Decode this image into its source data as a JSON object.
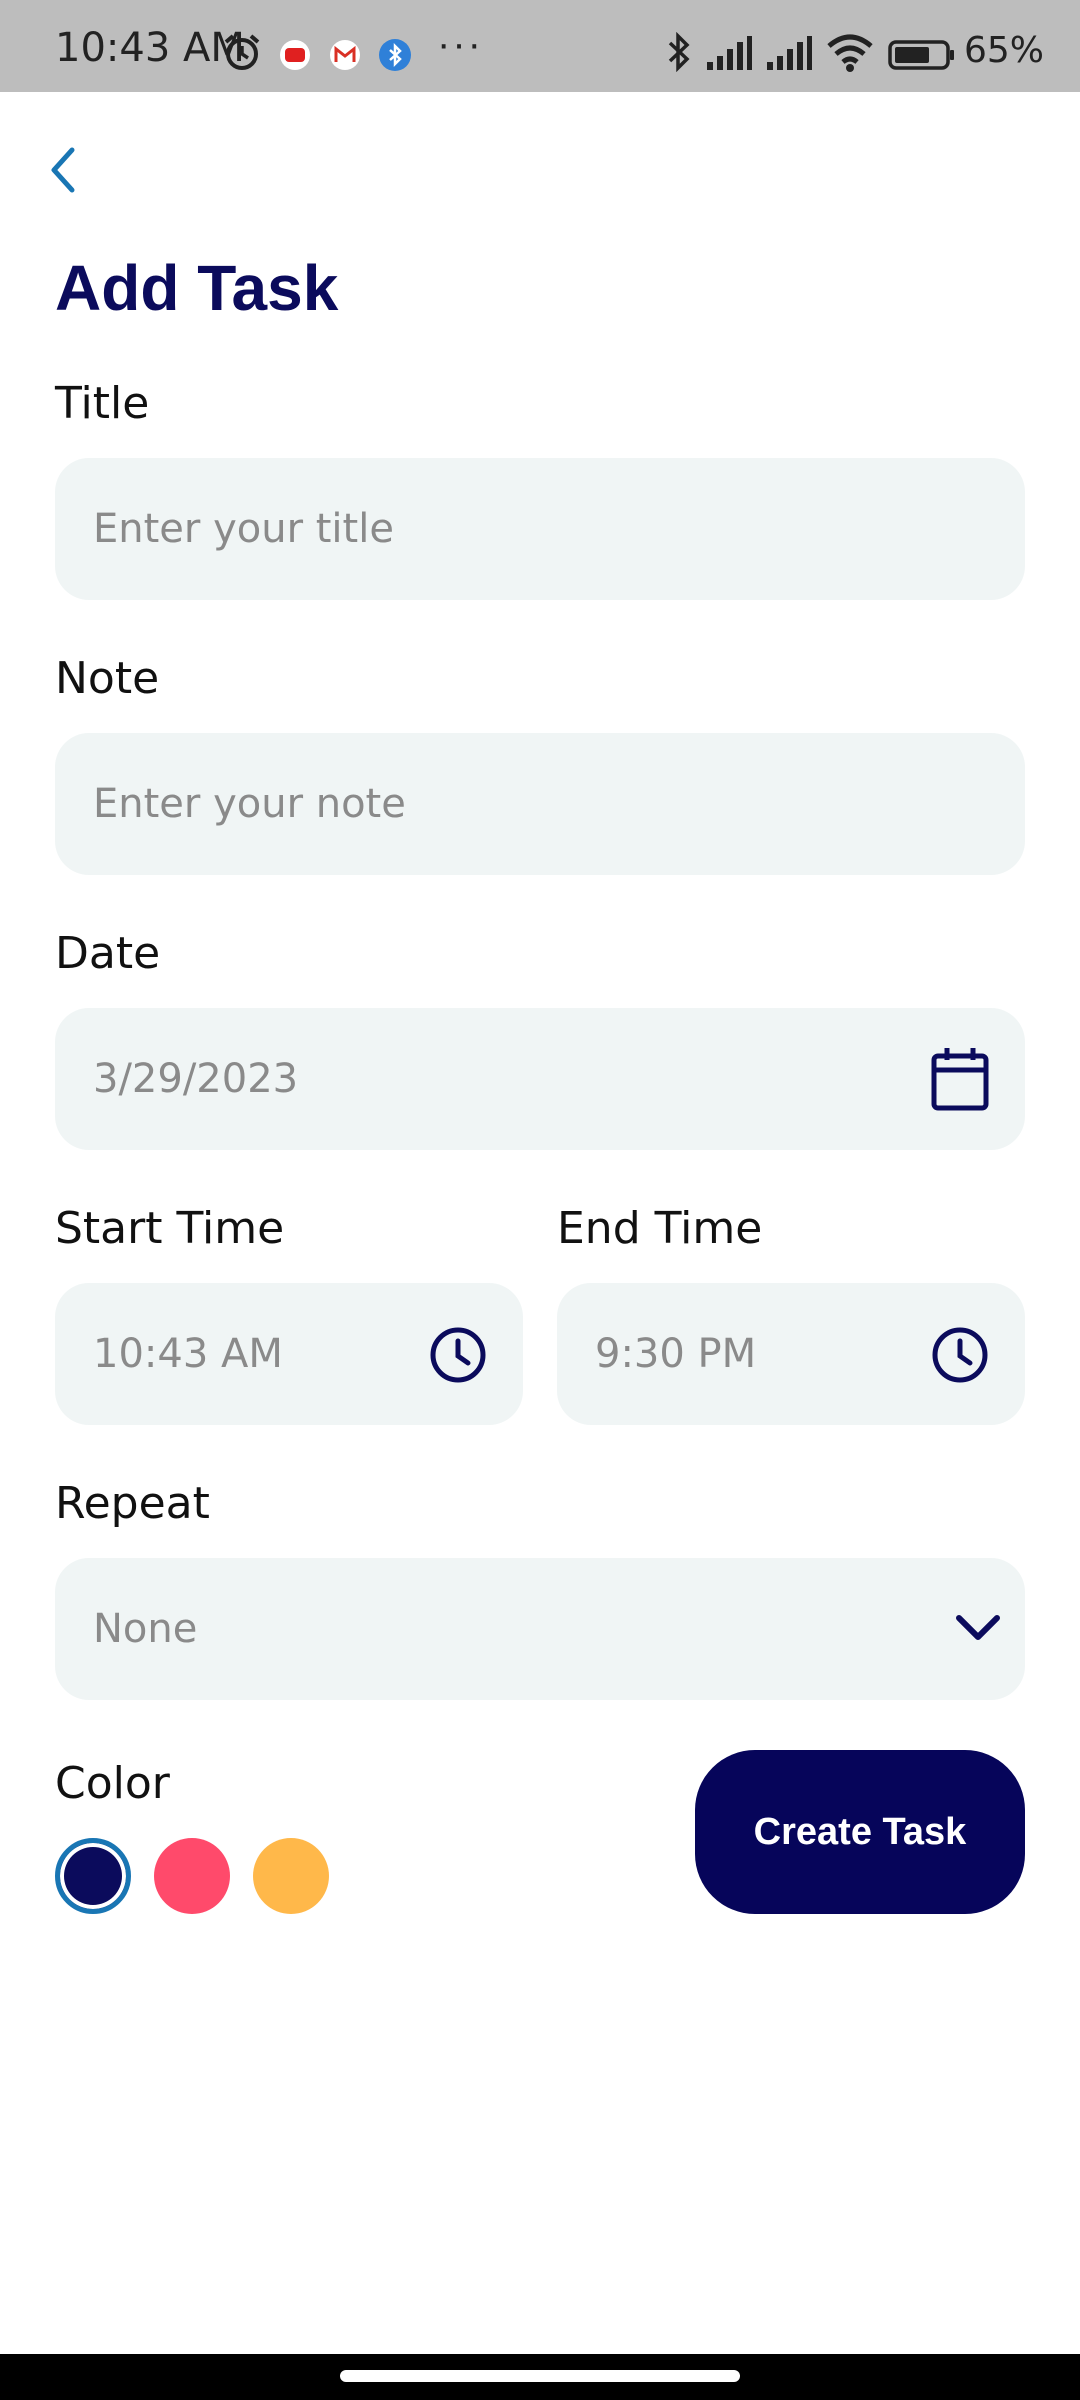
{
  "status_bar": {
    "time": "10:43 AM",
    "battery_percent": "65%",
    "icons": [
      "alarm-icon",
      "youtube-icon",
      "gmail-icon",
      "bluetooth-app-icon",
      "more-icon",
      "bluetooth-icon",
      "signal-icon",
      "signal-icon",
      "wifi-icon",
      "battery-icon"
    ],
    "more": "···"
  },
  "header": {
    "back_icon": "chevron-left-icon",
    "title": "Add Task"
  },
  "form": {
    "title": {
      "label": "Title",
      "placeholder": "Enter your title"
    },
    "note": {
      "label": "Note",
      "placeholder": "Enter your note"
    },
    "date": {
      "label": "Date",
      "value": "3/29/2023",
      "icon": "calendar-icon"
    },
    "start_time": {
      "label": "Start Time",
      "value": "10:43 AM",
      "icon": "clock-icon"
    },
    "end_time": {
      "label": "End Time",
      "value": "9:30 PM",
      "icon": "clock-icon"
    },
    "repeat": {
      "label": "Repeat",
      "value": "None",
      "icon": "chevron-down-icon"
    },
    "color": {
      "label": "Color",
      "options": [
        "#0b0b5c",
        "#ff4a6b",
        "#ffb84a"
      ],
      "selected_index": 0
    }
  },
  "actions": {
    "create_label": "Create Task"
  },
  "colors": {
    "accent": "#06055a",
    "field_bg": "#f0f5f5",
    "back_icon": "#1976b4"
  }
}
